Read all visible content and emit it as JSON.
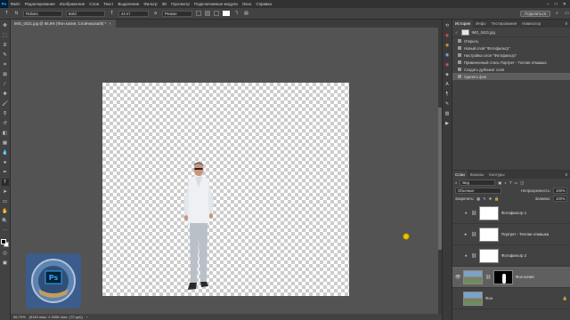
{
  "menubar": {
    "items": [
      "Файл",
      "Редактирование",
      "Изображение",
      "Слои",
      "Текст",
      "Выделение",
      "Фильтр",
      "3D",
      "Просмотр",
      "Подключаемые модули",
      "Окно",
      "Справка"
    ]
  },
  "options_bar": {
    "font_family": "Roboto",
    "font_style": "Bold",
    "font_size": "44 пт",
    "antialias": "Резкое",
    "share_label": "Поделиться"
  },
  "document_tab": {
    "title": "IMG_0421.jpg @ 66,8% (Фон копия, Слой-маска/8) *"
  },
  "status_bar": {
    "zoom": "66,79%",
    "doc_info": "(5184 пикс. x 3456 пикс. (72 ppi))"
  },
  "history_panel": {
    "tabs": [
      "История",
      "Инфо",
      "Тестирования",
      "Навигатор"
    ],
    "document_name": "IMG_0421.jpg",
    "items": [
      "Открыть",
      "Новый слой \"Фотофильтр\"",
      "Настройка слоя \"Фотофильтр\"",
      "Примененный стиль Портрет - Теплая отмашка",
      "Создать дубликат слоя",
      "Удалить фон"
    ],
    "selected_index": 5
  },
  "layers_panel": {
    "tabs": [
      "Слои",
      "Каналы",
      "Контуры"
    ],
    "filter_label": "Вид",
    "blend_mode": "Обычные",
    "opacity_label": "Непрозрачность:",
    "opacity_value": "100%",
    "lock_label": "Закрепить:",
    "fill_label": "Заливка:",
    "fill_value": "100%",
    "layers": [
      {
        "name": "Фотофильтр 1",
        "kind": "adjustment",
        "visible": false
      },
      {
        "name": "Портрет - Теплая отмашка",
        "kind": "group",
        "visible": false
      },
      {
        "name": "Фотофильтр 2",
        "kind": "adjustment",
        "visible": false
      },
      {
        "name": "Фон копия",
        "kind": "masked",
        "visible": true,
        "selected": true
      },
      {
        "name": "Фон",
        "kind": "background",
        "visible": false
      }
    ]
  },
  "colors": {
    "accent": "#31a8ff",
    "panel": "#424242",
    "canvas_bg": "#535353"
  }
}
